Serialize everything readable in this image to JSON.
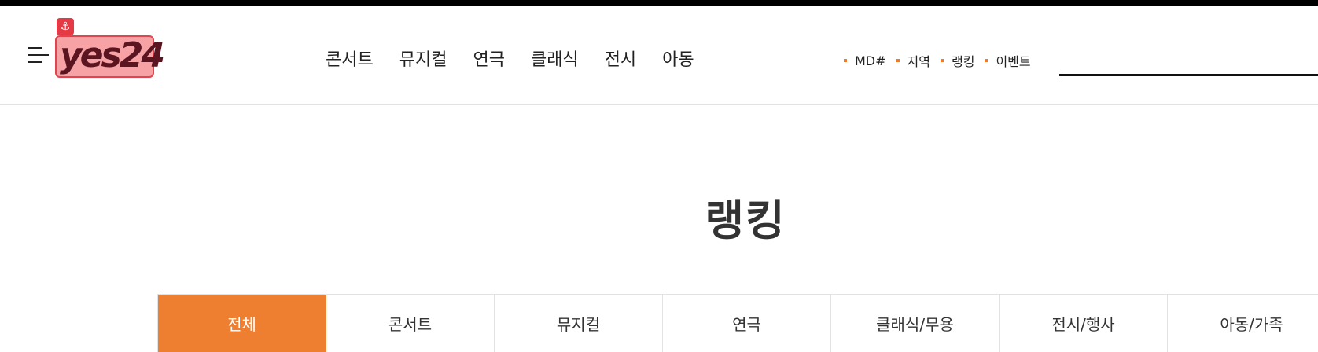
{
  "header": {
    "logo_text": "yes24",
    "main_nav": [
      "콘서트",
      "뮤지컬",
      "연극",
      "클래식",
      "전시",
      "아동"
    ],
    "sub_nav": [
      "MD#",
      "지역",
      "랭킹",
      "이벤트"
    ],
    "colors": {
      "accent": "#ee7e30",
      "dot": "#f07a2a",
      "logo_fill": "#f7a3a6",
      "logo_border": "#e0454f",
      "logo_text": "#5b1520"
    }
  },
  "page": {
    "title": "랭킹"
  },
  "tabs": [
    {
      "label": "전체",
      "active": true
    },
    {
      "label": "콘서트",
      "active": false
    },
    {
      "label": "뮤지컬",
      "active": false
    },
    {
      "label": "연극",
      "active": false
    },
    {
      "label": "클래식/무용",
      "active": false
    },
    {
      "label": "전시/행사",
      "active": false
    },
    {
      "label": "아동/가족",
      "active": false
    }
  ],
  "icons": {
    "menu": "hamburger-icon",
    "logo_badge": "anchor-icon"
  }
}
